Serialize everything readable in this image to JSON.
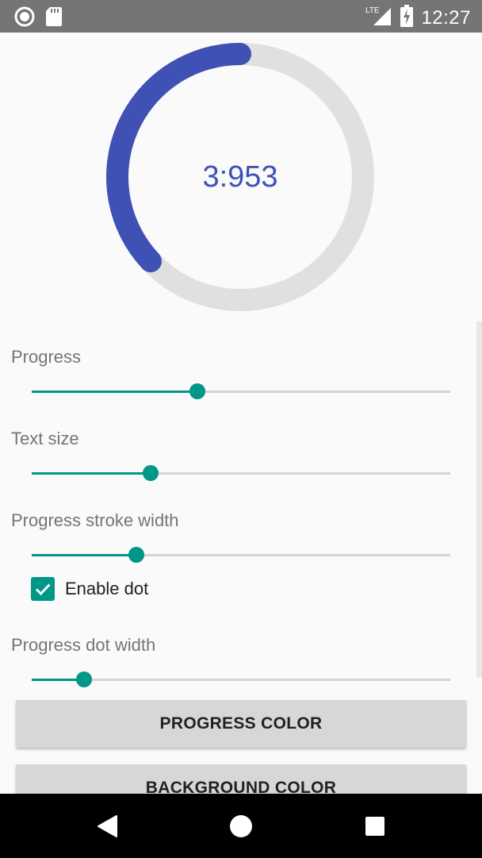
{
  "status_bar": {
    "time": "12:27",
    "network": "LTE",
    "icons": [
      "circle-notification-icon",
      "sd-card-icon",
      "signal-icon",
      "battery-charging-icon"
    ]
  },
  "progress_display": {
    "value_text": "3:953",
    "progress_fraction": 0.37,
    "progress_color": "#3f51b5",
    "background_color": "#e0e0e0"
  },
  "controls": {
    "progress": {
      "label": "Progress",
      "value": 0.395
    },
    "text_size": {
      "label": "Text size",
      "value": 0.285
    },
    "stroke_width": {
      "label": "Progress stroke width",
      "value": 0.25
    },
    "enable_dot": {
      "label": "Enable dot",
      "checked": true
    },
    "dot_width": {
      "label": "Progress dot width",
      "value": 0.125
    }
  },
  "buttons": {
    "progress_color": "PROGRESS COLOR",
    "background_color": "BACKGROUND COLOR"
  },
  "nav": {
    "icons": [
      "back-icon",
      "home-icon",
      "recents-icon"
    ]
  },
  "colors": {
    "accent": "#009688",
    "primary": "#3f51b5"
  }
}
